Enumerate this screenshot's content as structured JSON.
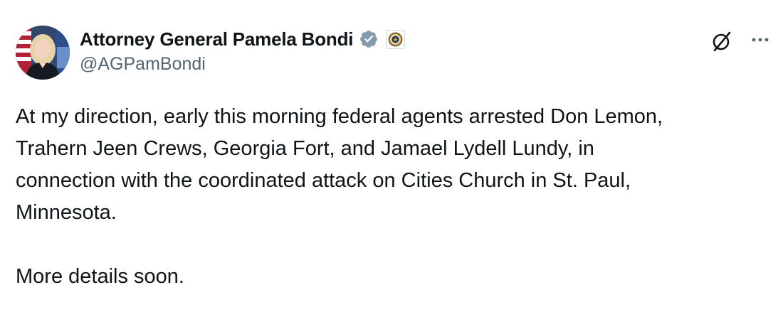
{
  "author": {
    "display_name": "Attorney General Pamela Bondi",
    "handle": "@AGPamBondi",
    "verified_badge_icon": "verified-check-icon",
    "affiliate_badge_icon": "doj-seal-icon",
    "avatar": "profile-photo"
  },
  "actions": {
    "grok_icon": "slashed-circle-icon",
    "more_icon": "more-options-icon"
  },
  "tweet": {
    "lines": [
      "At my direction, early this morning federal agents arrested Don Lemon,",
      "Trahern Jeen Crews, Georgia Fort, and Jamael Lydell Lundy, in",
      "connection with the coordinated attack on Cities Church in St. Paul,",
      "Minnesota."
    ],
    "closing": "More details soon."
  },
  "colors": {
    "text": "#0f1419",
    "secondary": "#536471",
    "verified_badge": "#829aab",
    "background": "#ffffff"
  }
}
